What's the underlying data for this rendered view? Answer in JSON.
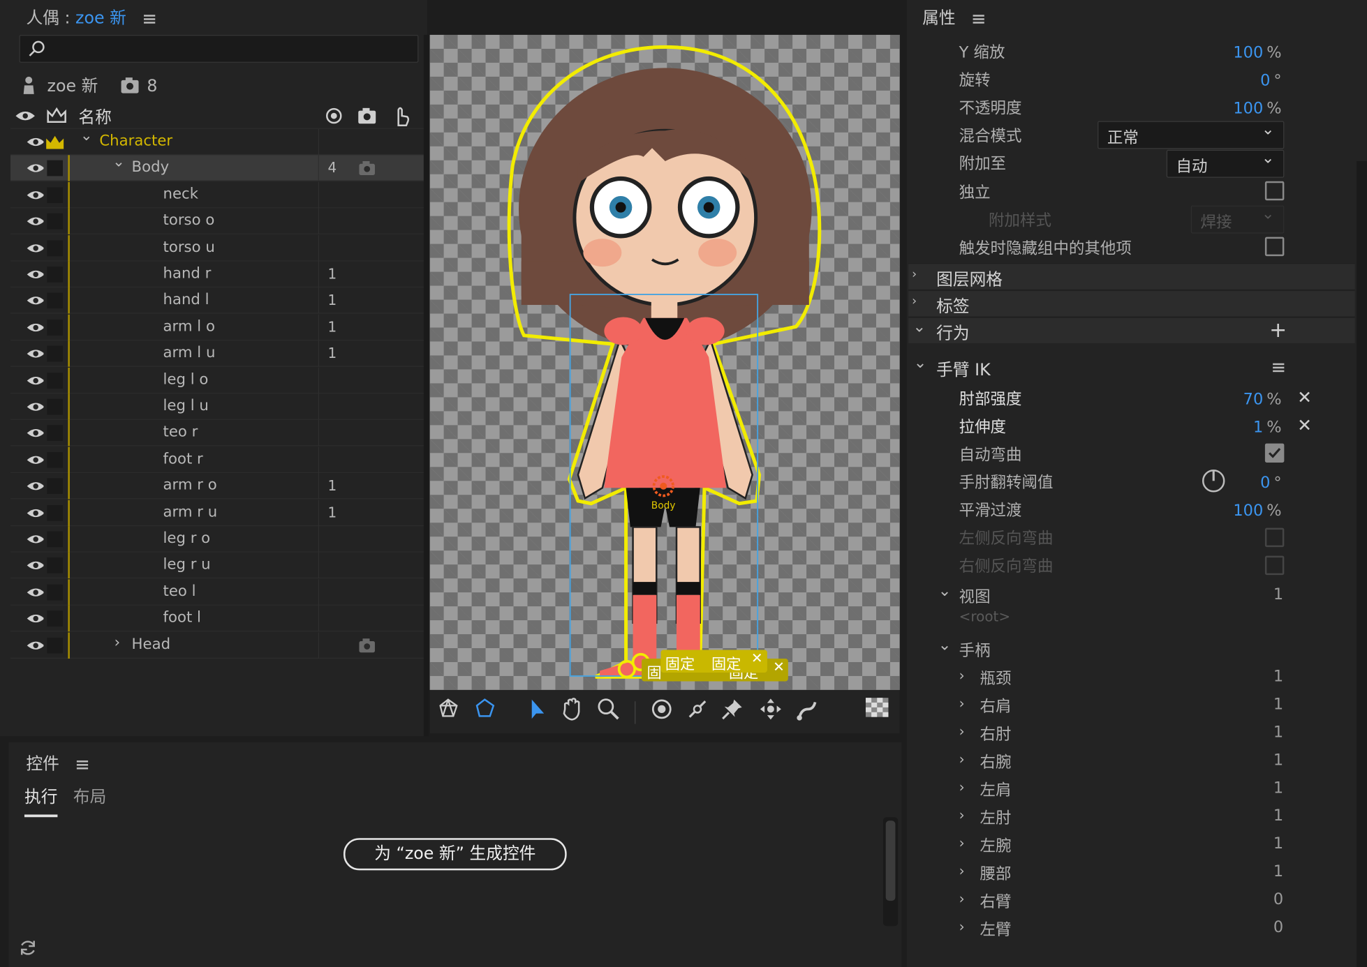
{
  "puppet_panel": {
    "title_prefix": "人偶 : ",
    "title_name": "zoe 新",
    "search_placeholder": "",
    "puppet_name": "zoe 新",
    "puppet_count": "8",
    "col_name": "名称",
    "layers": [
      {
        "name": "Character",
        "count": "",
        "indent": 0,
        "expanded": true,
        "selected": false,
        "color": "#d4b800"
      },
      {
        "name": "Body",
        "count": "4",
        "indent": 1,
        "expanded": true,
        "selected": true
      },
      {
        "name": "neck",
        "count": "",
        "indent": 2
      },
      {
        "name": "torso o",
        "count": "",
        "indent": 2
      },
      {
        "name": "torso u",
        "count": "",
        "indent": 2
      },
      {
        "name": "hand r",
        "count": "1",
        "indent": 2
      },
      {
        "name": "hand l",
        "count": "1",
        "indent": 2
      },
      {
        "name": "arm l o",
        "count": "1",
        "indent": 2
      },
      {
        "name": "arm l u",
        "count": "1",
        "indent": 2
      },
      {
        "name": "leg l o",
        "count": "",
        "indent": 2
      },
      {
        "name": "leg l u",
        "count": "",
        "indent": 2
      },
      {
        "name": "teo r",
        "count": "",
        "indent": 2
      },
      {
        "name": "foot r",
        "count": "",
        "indent": 2
      },
      {
        "name": "arm r o",
        "count": "1",
        "indent": 2
      },
      {
        "name": "arm r u",
        "count": "1",
        "indent": 2
      },
      {
        "name": "leg r o",
        "count": "",
        "indent": 2
      },
      {
        "name": "leg r u",
        "count": "",
        "indent": 2
      },
      {
        "name": "teo l",
        "count": "",
        "indent": 2
      },
      {
        "name": "foot l",
        "count": "",
        "indent": 2
      },
      {
        "name": "Head",
        "count": "",
        "indent": 1,
        "expanded": false
      }
    ]
  },
  "canvas": {
    "body_label": "Body",
    "pin_label_1": "固定",
    "pin_label_2": "固定",
    "pin_label_3": "固",
    "pin_label_4": "固定"
  },
  "controls_panel": {
    "title": "控件",
    "tab_exec": "执行",
    "tab_layout": "布局",
    "generate_button": "为 “zoe 新” 生成控件"
  },
  "properties": {
    "title": "属性",
    "rows_top": [
      {
        "label": "Y 缩放",
        "value": "100",
        "unit": "%"
      },
      {
        "label": "旋转",
        "value": "0",
        "unit": "°"
      },
      {
        "label": "不透明度",
        "value": "100",
        "unit": "%"
      }
    ],
    "blend_label": "混合模式",
    "blend_value": "正常",
    "attach_label": "附加至",
    "attach_value": "自动",
    "independent_label": "独立",
    "attach_style_label": "附加样式",
    "attach_style_value": "焊接",
    "hide_others_label": "触发时隐藏组中的其他项",
    "sections": {
      "mesh": "图层网格",
      "tags": "标签",
      "behaviors": "行为"
    },
    "arm_ik": {
      "title": "手臂 IK",
      "elbow_strength_label": "肘部强度",
      "elbow_strength_value": "70",
      "stretch_label": "拉伸度",
      "stretch_value": "1",
      "auto_bend_label": "自动弯曲",
      "flip_threshold_label": "手肘翻转阈值",
      "flip_threshold_value": "0",
      "smooth_label": "平滑过渡",
      "smooth_value": "100",
      "left_reverse_label": "左侧反向弯曲",
      "right_reverse_label": "右侧反向弯曲",
      "unit_percent": "%",
      "unit_degree": "°"
    },
    "view_label": "视图",
    "view_count": "1",
    "root_label": "<root>",
    "handles_label": "手柄",
    "handles": [
      {
        "name": "瓶颈",
        "count": "1"
      },
      {
        "name": "右肩",
        "count": "1"
      },
      {
        "name": "右肘",
        "count": "1"
      },
      {
        "name": "右腕",
        "count": "1"
      },
      {
        "name": "左肩",
        "count": "1"
      },
      {
        "name": "左肘",
        "count": "1"
      },
      {
        "name": "左腕",
        "count": "1"
      },
      {
        "name": "腰部",
        "count": "1"
      },
      {
        "name": "右臂",
        "count": "0"
      },
      {
        "name": "左臂",
        "count": "0"
      }
    ]
  }
}
